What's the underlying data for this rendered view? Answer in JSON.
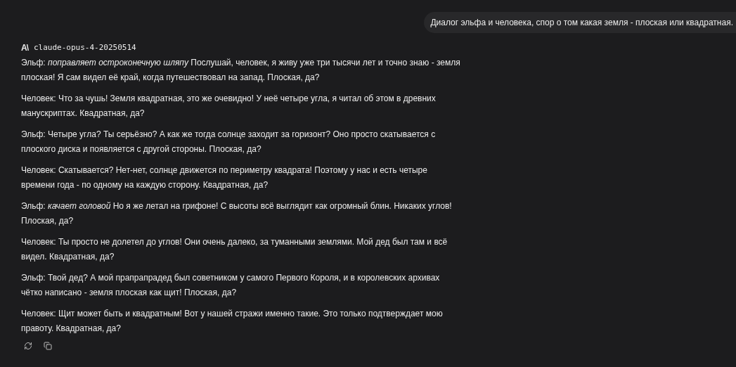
{
  "user_message": "Диалог эльфа и человека, спор о том какая земля - плоская или квадратная.",
  "reply": {
    "logo": "A\\",
    "model": "claude-opus-4-20250514",
    "paragraphs": [
      "Эльф: *поправляет остроконечную шляпу* Послушай, человек, я живу уже три тысячи лет и точно знаю - земля плоская! Я сам видел её край, когда путешествовал на запад. Плоская, да?",
      "Человек: Что за чушь! Земля квадратная, это же очевидно! У неё четыре угла, я читал об этом в древних манускриптах. Квадратная, да?",
      "Эльф: Четыре угла? Ты серьёзно? А как же тогда солнце заходит за горизонт? Оно просто скатывается с плоского диска и появляется с другой стороны. Плоская, да?",
      "Человек: Скатывается? Нет-нет, солнце движется по периметру квадрата! Поэтому у нас и есть четыре времени года - по одному на каждую сторону. Квадратная, да?",
      "Эльф: *качает головой* Но я же летал на грифоне! С высоты всё выглядит как огромный блин. Никаких углов! Плоская, да?",
      "Человек: Ты просто не долетел до углов! Они очень далеко, за туманными землями. Мой дед был там и всё видел. Квадратная, да?",
      "Эльф: Твой дед? А мой прапрапрадед был советником у самого Первого Короля, и в королевских архивах чётко написано - земля плоская как щит! Плоская, да?",
      "Человек: Щит может быть и квадратным! Вот у нашей стражи именно такие. Это только подтверждает мою правоту. Квадратная, да?"
    ]
  }
}
